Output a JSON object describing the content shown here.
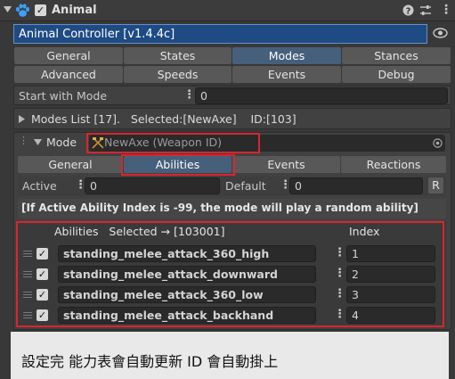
{
  "header": {
    "title": "Animal",
    "checked": true
  },
  "controller_bar": {
    "label": "Animal Controller [v1.4.4c]"
  },
  "main_tabs": {
    "row1": [
      "General",
      "States",
      "Modes",
      "Stances"
    ],
    "row2": [
      "Advanced",
      "Speeds",
      "Events",
      "Debug"
    ],
    "selected": "Modes"
  },
  "start_with_mode": {
    "label": "Start with Mode",
    "value": "0"
  },
  "modes_list": {
    "label": "Modes List [17].   Selected:[NewAxe]    ID:[103]"
  },
  "mode": {
    "label": "Mode",
    "value": "NewAxe (Weapon ID)"
  },
  "mode_tabs": {
    "items": [
      "General",
      "Abilities",
      "Events",
      "Reactions"
    ],
    "selected": "Abilities"
  },
  "active_row": {
    "active_label": "Active",
    "active_value": "0",
    "default_label": "Default",
    "default_value": "0",
    "reset_label": "R"
  },
  "info": {
    "text": "[If Active Ability Index is -99, the mode will play a random ability]"
  },
  "abilities": {
    "header_left": "Abilities   Selected → [103001]",
    "header_right": "Index",
    "rows": [
      {
        "name": "standing_melee_attack_360_high",
        "index": "1",
        "checked": true
      },
      {
        "name": "standing_melee_attack_downward",
        "index": "2",
        "checked": true
      },
      {
        "name": "standing_melee_attack_360_low",
        "index": "3",
        "checked": true
      },
      {
        "name": "standing_melee_attack_backhand",
        "index": "4",
        "checked": true
      }
    ]
  },
  "caption": {
    "text": "設定完 能力表會自動更新 ID 會自動掛上"
  },
  "colors": {
    "highlight": "#d8262e",
    "selected_tab": "#46607c",
    "controller_bar": "#1e4b84"
  }
}
